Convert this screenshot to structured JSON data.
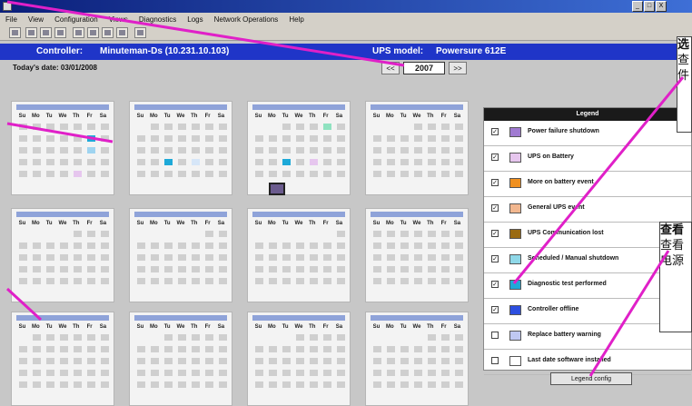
{
  "window": {
    "title": "",
    "buttons": [
      "_",
      "□",
      "X"
    ]
  },
  "menu": [
    "File",
    "View",
    "Configuration",
    "Views",
    "Diagnostics",
    "Logs",
    "Network Operations",
    "Help"
  ],
  "toolbar_icons": [
    "open-icon",
    "network-icon",
    "monitor-icon",
    "display-icon",
    "copy-icon",
    "print-icon",
    "save-icon",
    "export-icon",
    "help-icon"
  ],
  "band": {
    "controller_label": "Controller:",
    "controller_value": "Minuteman-Ds (10.231.10.103)",
    "ups_label": "UPS model:",
    "ups_value": "Powersure 612E"
  },
  "today": "Today's date: 03/01/2008",
  "year": {
    "prev": "<<",
    "value": "2007",
    "next": ">>"
  },
  "weekdays": [
    "Su",
    "Mo",
    "Tu",
    "We",
    "Th",
    "Fr",
    "Sa"
  ],
  "legend": {
    "header": "Legend",
    "items": [
      {
        "checked": "✓",
        "color": "#a07ad1",
        "label": "Power failure shutdown"
      },
      {
        "checked": "✓",
        "color": "#e6c6ee",
        "label": "UPS on Battery"
      },
      {
        "checked": "✓",
        "color": "#f0901f",
        "label": "More on battery event"
      },
      {
        "checked": "✓",
        "color": "#f2b78f",
        "label": "General UPS event"
      },
      {
        "checked": "✓",
        "color": "#9a6b12",
        "label": "UPS Communication lost"
      },
      {
        "checked": "✓",
        "color": "#8fd8e8",
        "label": "Scheduled / Manual shutdown"
      },
      {
        "checked": "✓",
        "color": "#1ea9d8",
        "label": "Diagnostic test performed"
      },
      {
        "checked": "✓",
        "color": "#2d4fe0",
        "label": "Controller offline"
      },
      {
        "checked": "",
        "color": "#bfc8f2",
        "label": "Replace battery warning"
      },
      {
        "checked": "",
        "color": "#ffffff",
        "label": "Last date ​software installed"
      }
    ]
  },
  "bottom_button": "Legend config",
  "callouts": {
    "top": {
      "title": "选",
      "lines": [
        "查",
        "件"
      ]
    },
    "mid": {
      "title": "查看",
      "lines": [
        "查看",
        "电源"
      ]
    }
  },
  "colors": {
    "arrow": "#e020c8",
    "band": "#1f35c8"
  }
}
